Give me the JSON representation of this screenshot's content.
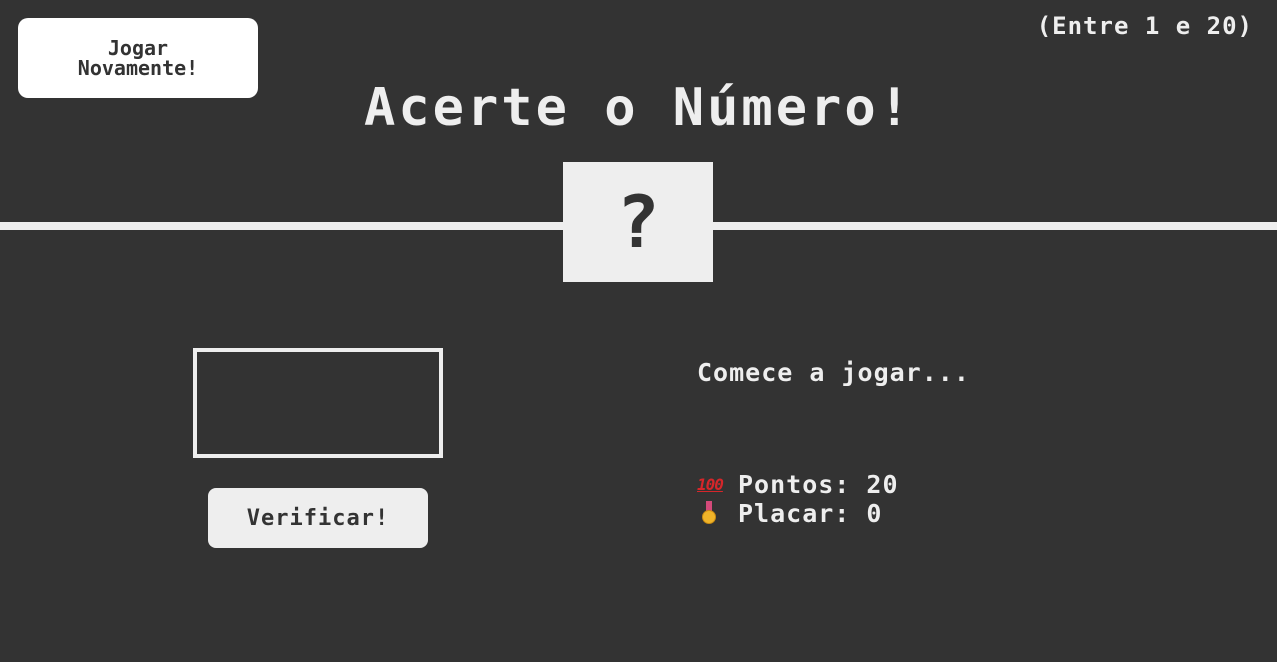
{
  "header": {
    "again_label_line1": "Jogar",
    "again_label_line2": "Novamente!",
    "between": "(Entre 1 e 20)",
    "title": "Acerte o Número!"
  },
  "secret": {
    "display": "?"
  },
  "guess": {
    "value": "",
    "placeholder": ""
  },
  "check_label": "Verificar!",
  "message": "Comece a jogar...",
  "stats": {
    "score_icon": "100-emoji",
    "score_label": "Pontos:",
    "score_value": "20",
    "highscore_icon": "medal-icon",
    "highscore_label": "Placar:",
    "highscore_value": "0"
  },
  "colors": {
    "background": "#333333",
    "foreground": "#eeeeee"
  }
}
